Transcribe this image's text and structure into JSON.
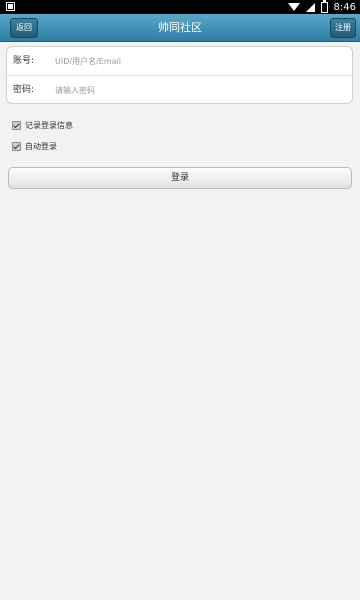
{
  "statusbar": {
    "time": "8:46"
  },
  "header": {
    "title": "帅同社区",
    "back_label": "返回",
    "register_label": "注册"
  },
  "form": {
    "account_label": "账号:",
    "account_placeholder": "UID/用户名/Email",
    "password_label": "密码:",
    "password_placeholder": "请输入密码"
  },
  "options": {
    "remember_label": "记录登录信息",
    "remember_checked": true,
    "autologin_label": "自动登录",
    "autologin_checked": true
  },
  "login_button_label": "登录",
  "colors": {
    "header_top": "#5aa7c8",
    "header_bottom": "#2e7ea5",
    "background": "#f2f2f2"
  }
}
